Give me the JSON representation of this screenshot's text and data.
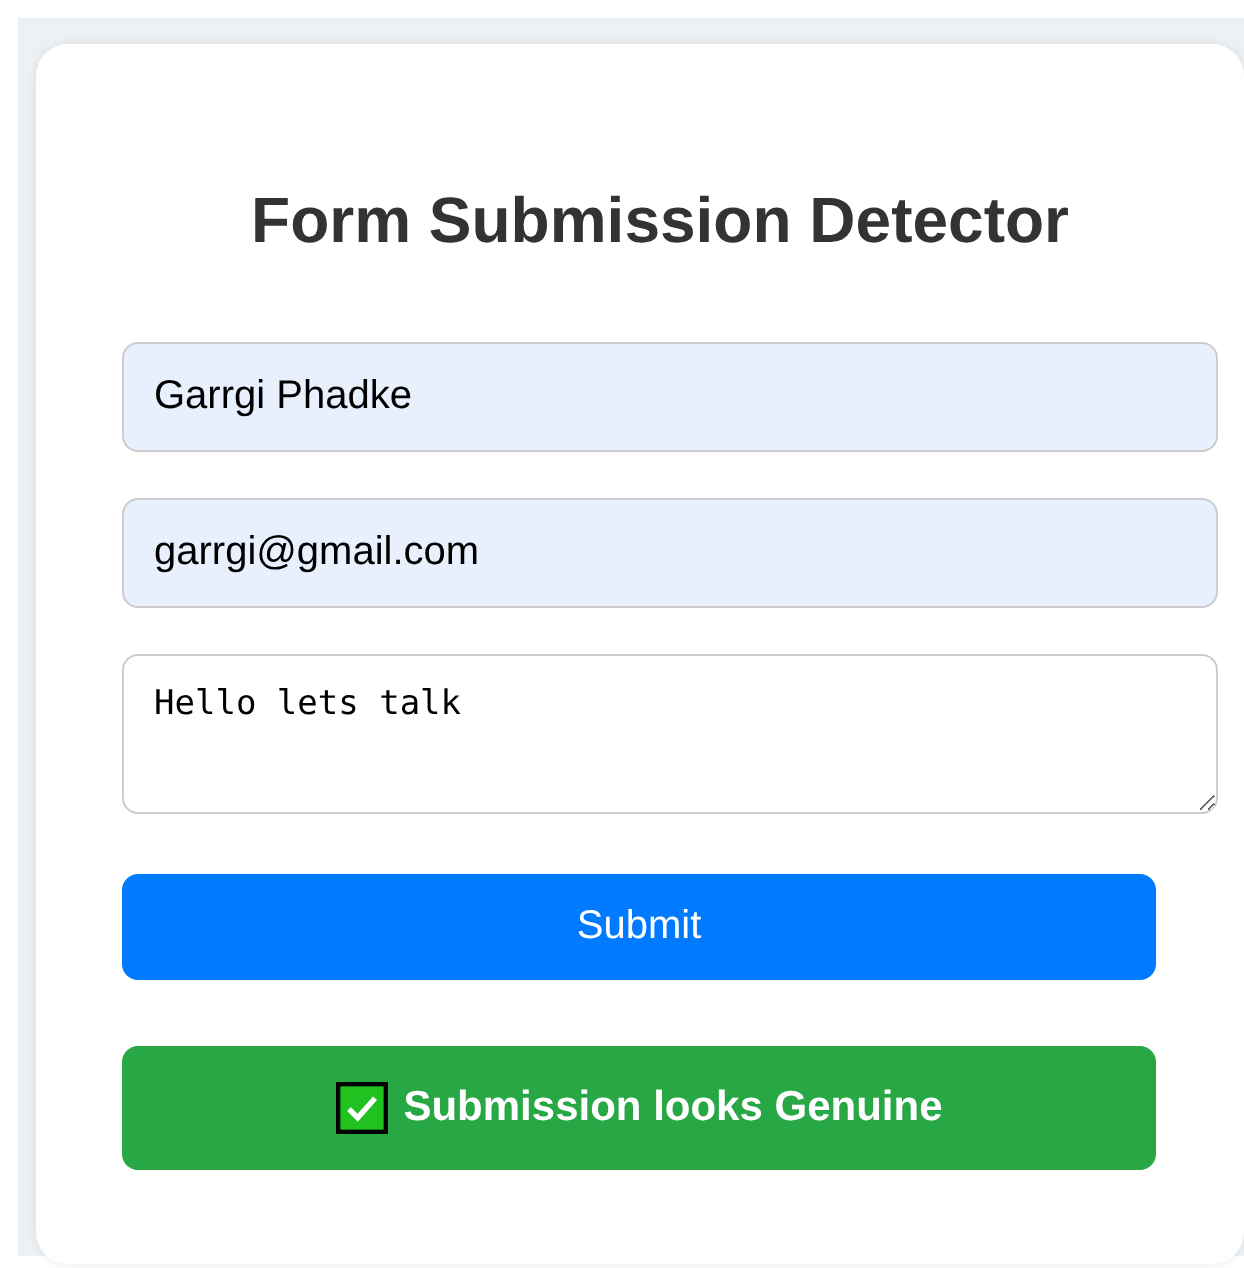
{
  "title": "Form Submission Detector",
  "fields": [
    {
      "kind": "input",
      "value": "Garrgi Phadke",
      "autofilled": true
    },
    {
      "kind": "input",
      "value": "garrgi@gmail.com",
      "autofilled": true
    },
    {
      "kind": "textarea",
      "value": "Hello lets talk",
      "autofilled": false
    }
  ],
  "submit": {
    "label": "Submit"
  },
  "result": {
    "kind": "genuine",
    "text": "Submission looks **Genuine**"
  }
}
